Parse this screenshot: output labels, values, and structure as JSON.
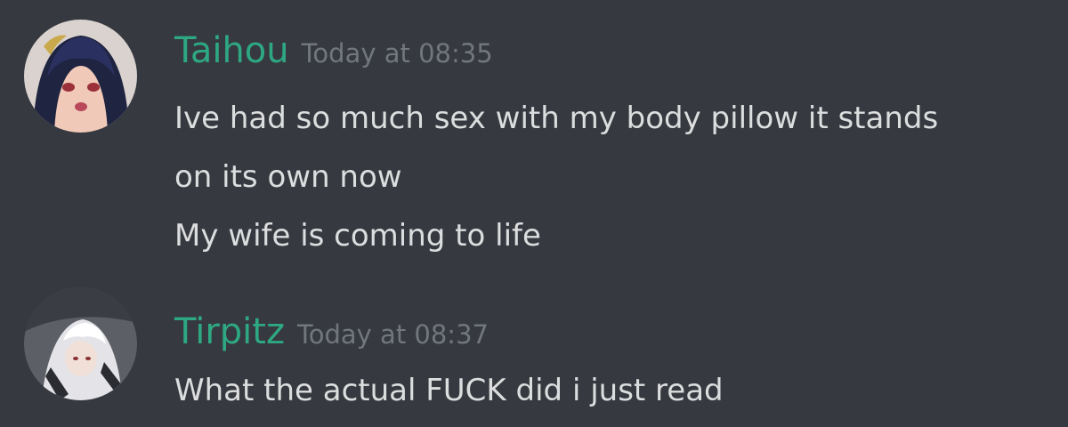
{
  "colors": {
    "background": "#36393f",
    "username": "#2ea882",
    "timestamp": "#72767d",
    "message_text": "#dcddde"
  },
  "messages": [
    {
      "author": "Taihou",
      "timestamp": "Today at 08:35",
      "avatar_icon": "anime-girl-avatar",
      "lines": [
        "Ive had so much sex with my body pillow it stands",
        "on its own now",
        "My wife is coming to life"
      ]
    },
    {
      "author": "Tirpitz",
      "timestamp": "Today at 08:37",
      "avatar_icon": "anime-girl-avatar",
      "lines": [
        "What the actual FUCK did i just read"
      ]
    }
  ]
}
